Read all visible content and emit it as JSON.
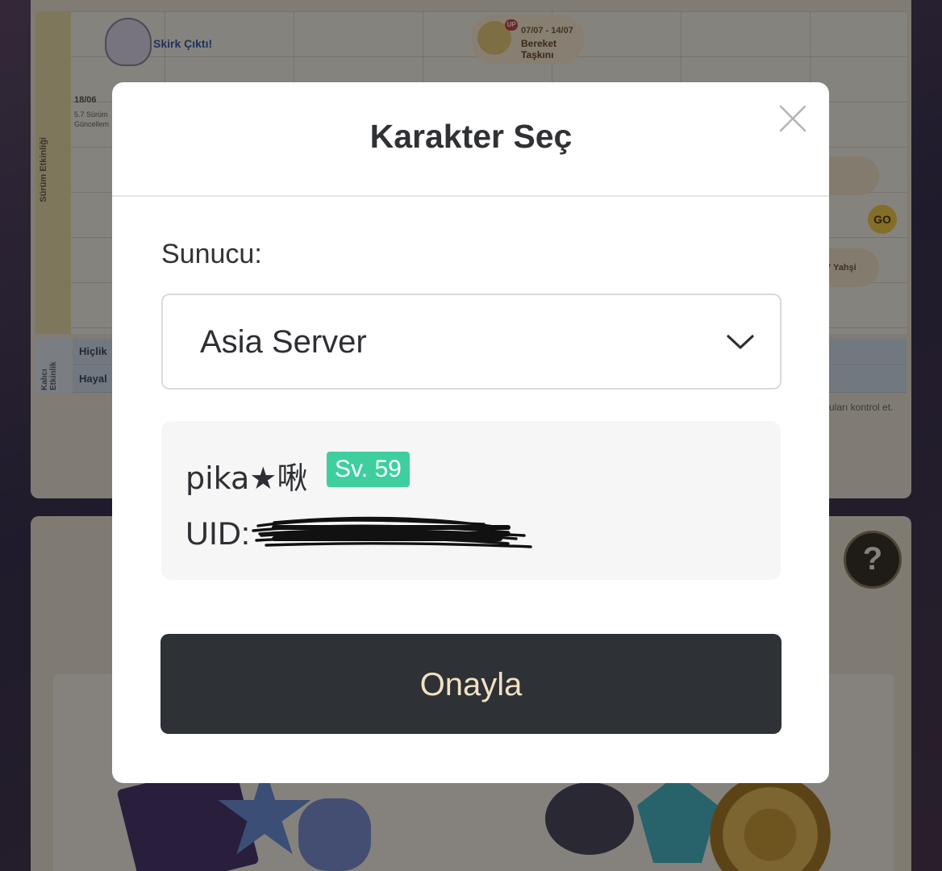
{
  "background": {
    "calendar": {
      "side_label": "Sürüm Etkinliği",
      "permanent_label": "Kalıcı Etkinlik",
      "event_skirk": "Skirk Çıktı!",
      "banner_date": "07/07 - 14/07",
      "banner_name": "Bereket Taşkını",
      "banner_tag": "UP",
      "update_date": "18/06",
      "update_text": "5.7 Sürüm Güncellem",
      "go_label": "GO",
      "pill_text": "7 Yahşi",
      "rows": [
        "Hiçlik",
        "Hayal"
      ],
      "hint": "uları kontrol et."
    },
    "help_glyph": "?"
  },
  "modal": {
    "title": "Karakter Seç",
    "close_icon": "close-icon",
    "server_label": "Sunucu:",
    "server_value": "Asia Server",
    "character": {
      "name": "pika★啾",
      "level": "Sv. 59",
      "uid_label": "UID:"
    },
    "confirm_label": "Onayla"
  },
  "colors": {
    "confirm_bg": "#2e3135",
    "confirm_text": "#f2e2c2",
    "level_badge": "#3fcf9f"
  }
}
